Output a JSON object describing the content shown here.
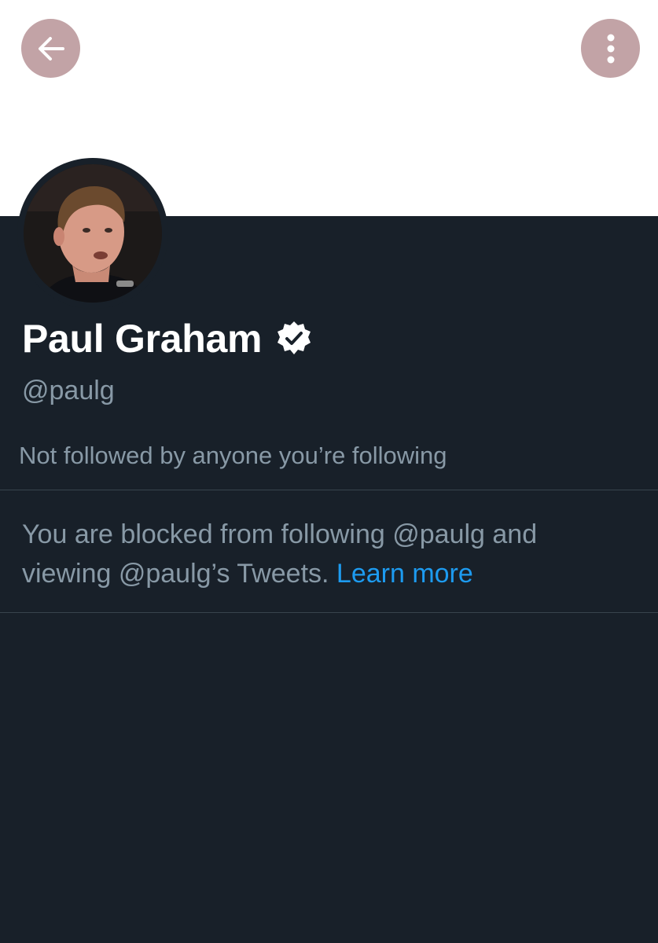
{
  "header": {
    "back_icon": "arrow-left-icon",
    "more_icon": "vertical-dots-icon",
    "button_color": "#c2a3a6"
  },
  "profile": {
    "display_name": "Paul Graham",
    "verified_icon": "verified-badge-icon",
    "handle": "@paulg",
    "followed_by_note": "Not followed by anyone you’re following"
  },
  "blocked": {
    "message_line1": "You are blocked from following @paulg and",
    "message_line2": "viewing @paulg’s Tweets.",
    "learn_more": "Learn more",
    "link_color": "#1d9bf0"
  },
  "theme": {
    "background": "#182029",
    "secondary_text": "#8899a6"
  }
}
